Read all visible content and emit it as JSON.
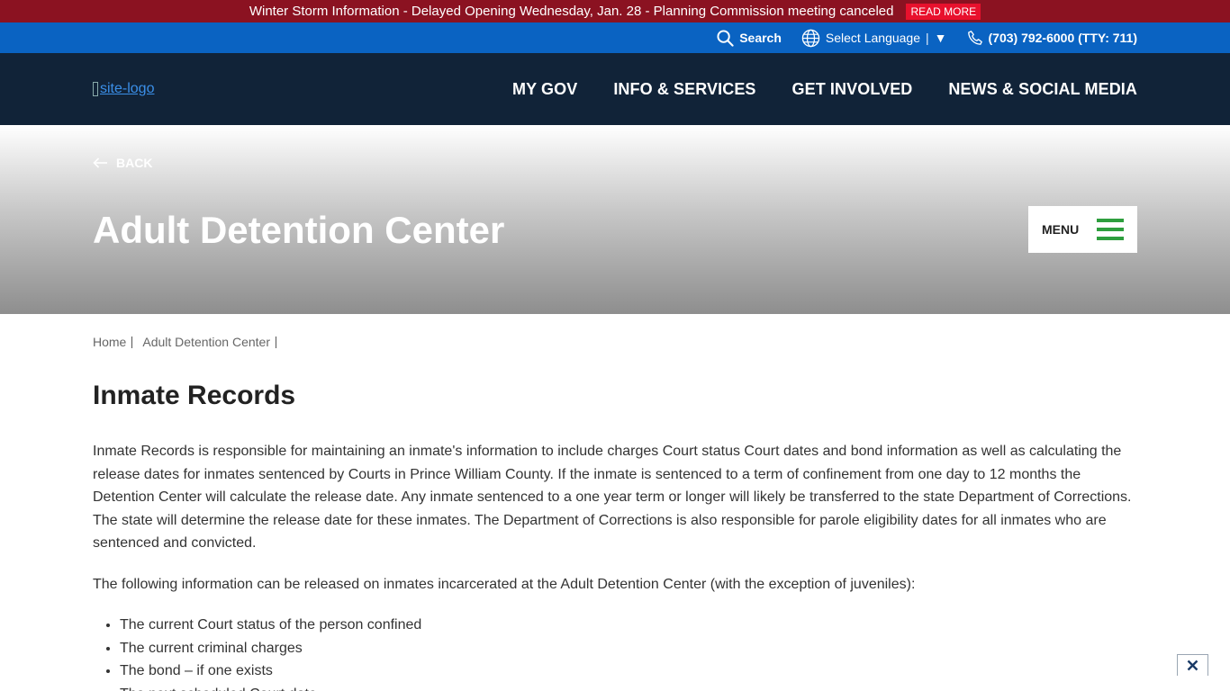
{
  "alert": {
    "text": "Winter Storm Information - Delayed Opening Wednesday, Jan. 28 - Planning Commission meeting canceled",
    "cta": "READ MORE"
  },
  "utility": {
    "search_label": "Search",
    "language_label": "Select Language",
    "language_separator": "|",
    "language_arrow": "▼",
    "phone": "(703) 792-6000 (TTY: 711)"
  },
  "header": {
    "logo_alt": "site-logo",
    "nav": [
      "MY GOV",
      "INFO & SERVICES",
      "GET INVOLVED",
      "NEWS & SOCIAL MEDIA"
    ]
  },
  "hero": {
    "back_label": "BACK",
    "title": "Adult Detention Center",
    "menu_label": "MENU"
  },
  "breadcrumb": [
    "Home",
    "Adult Detention Center"
  ],
  "main": {
    "heading": "Inmate Records",
    "paragraph1": "Inmate Records is responsible for maintaining an inmate's information to include charges Court status Court dates and bond information as well as calculating the release dates for inmates sentenced by Courts in Prince William County. If the inmate is sentenced to a term of confinement from one day to 12 months the Detention Center will calculate the release date. Any inmate sentenced to a one year term or longer will likely be transferred to the state Department of Corrections. The state will determine the release date for these inmates. The Department of Corrections is also responsible for parole eligibility dates for all inmates who are sentenced and convicted.",
    "paragraph2": "The following information can be released on inmates incarcerated at the Adult Detention Center (with the exception of juveniles):",
    "list": [
      "The current Court status of the person confined",
      "The current criminal charges",
      "The bond – if one exists",
      "The next scheduled Court date"
    ]
  },
  "colors": {
    "alert_bg": "#8b1221",
    "read_more_bg": "#e8112d",
    "utility_bg": "#0a63c2",
    "nav_bg": "#112338",
    "menu_icon": "#2e9e3e"
  },
  "icons": [
    "search-icon",
    "globe-icon",
    "phone-icon",
    "arrow-left-icon",
    "hamburger-icon",
    "close-icon"
  ]
}
